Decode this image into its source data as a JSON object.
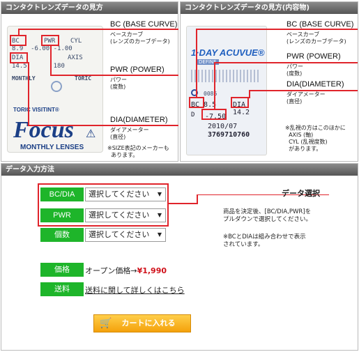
{
  "left_panel": {
    "header": "コンタクトレンズデータの見方",
    "bc_label": "BC (BASE CURVE)",
    "bc_desc": "ベースカーブ\n(レンズのカーブデータ)",
    "pwr_label": "PWR (POWER)",
    "pwr_desc": "パワー\n(度数)",
    "dia_label": "DIA(DIAMETER)",
    "dia_desc": "ダイアメーター\n(直径)",
    "note": "※SIZE表記のメーカーも\n  あります。",
    "pkg": {
      "bc": "BC",
      "pwr": "PWR",
      "cyl": "CYL",
      "row1": "8.9  -6.00 -1.00",
      "dia": "DIA",
      "axis": "AXIS",
      "row2": "14.5       180",
      "monthly": "MONTHLY",
      "toric": "TORIC",
      "brand_line": "TORIC VISITINT®",
      "logo": "Focus",
      "sub": "MONTHLY LENSES"
    }
  },
  "right_panel": {
    "header": "コンタクトレンズデータの見方(内容物)",
    "bc_label": "BC (BASE CURVE)",
    "bc_desc": "ベースカーブ\n(レンズのカーブデータ)",
    "pwr_label": "PWR (POWER)",
    "pwr_desc": "パワー\n(度数)",
    "dia_label": "DIA(DIAMETER)",
    "dia_desc": "ダイアメーター\n(直径)",
    "note": "※乱視の方はこのほかに\n  AXIS (軸)\n  CYL (乱視度数)\n  があります。",
    "pkg": {
      "logo": "1·DAY ACUVUE®",
      "define": "DEFINE",
      "bc": "BC 8.5",
      "dia": "DIA 14.2",
      "pwr": "-7.50",
      "date": "2010/07",
      "lot": "3769710760",
      "d": "D",
      "code": "0086"
    }
  },
  "entry": {
    "header": "データ入力方法",
    "rows": [
      {
        "label": "BC/DIA",
        "select": "選択してください"
      },
      {
        "label": "PWR",
        "select": "選択してください"
      },
      {
        "label": "個数",
        "select": "選択してください"
      }
    ],
    "select_title": "データ選択",
    "select_desc": "商品を決定後、[BC/DIA,PWR]を\nプルダウンで選択してください。",
    "combo_note": "※BCとDIAは組み合わせで表示\nされています。",
    "price_label": "価格",
    "price_text": "オープン価格→",
    "price_value": "¥1,990",
    "shipping_label": "送料",
    "shipping_link": "送料に関して詳しくはこちら",
    "cart_button": "カートに入れる"
  },
  "colors": {
    "accent_red": "#e0242b",
    "label_green": "#1eb52a",
    "cart_orange": "#f4a10b"
  }
}
